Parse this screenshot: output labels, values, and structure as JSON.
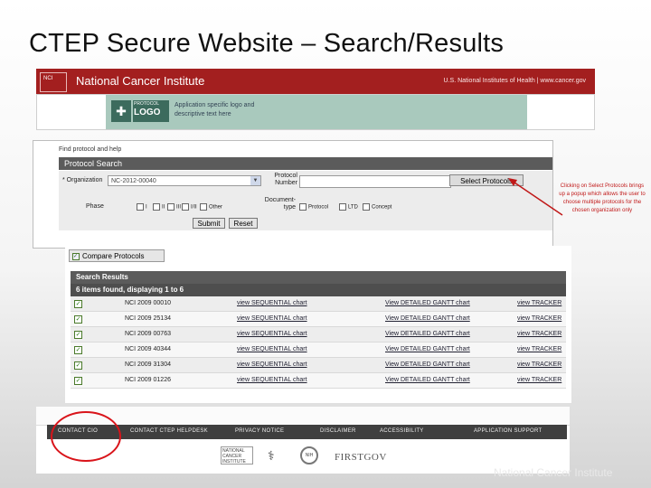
{
  "slide_title": "CTEP Secure Website – Search/Results",
  "banner": {
    "logo_text": "NATIONAL CANCER INSTITUTE",
    "name": "National Cancer Institute",
    "nih_link": "U.S. National Institutes of Health | www.cancer.gov"
  },
  "app_header": {
    "logo_small": "PROTOCOL",
    "logo_big": "LOGO",
    "description": "Application specific logo and descriptive text here"
  },
  "search": {
    "help_link": "Find protocol and help",
    "header": "Protocol Search",
    "organization_label": "* Organization",
    "organization_value": "NC-2012-00040",
    "protocol_number_label": "Protocol Number",
    "select_button": "Select Protocols",
    "phase_label": "Phase",
    "phases": [
      "I",
      "II",
      "III",
      "I/II",
      "Other"
    ],
    "document_type_label": "Document-type",
    "document_types": [
      "Protocol",
      "LTD",
      "Concept"
    ],
    "submit_button": "Submit",
    "reset_button": "Reset"
  },
  "callout": "Clicking on Select Protocols brings up a popup which allows the user to choose multiple protocols for the chosen organization only",
  "compare_button": "Compare Protocols",
  "results": {
    "title": "Search Results",
    "summary": "6 items found, displaying 1 to 6",
    "rows": [
      {
        "id": "NCI 2009 00010",
        "seq": "view SEQUENTIAL chart",
        "gantt": "View DETAILED GANTT chart",
        "tracker": "view TRACKER"
      },
      {
        "id": "NCI 2009 25134",
        "seq": "view SEQUENTIAL chart",
        "gantt": "View DETAILED GANTT chart",
        "tracker": "view TRACKER"
      },
      {
        "id": "NCI 2009 00763",
        "seq": "view SEQUENTIAL chart",
        "gantt": "View DETAILED GANTT chart",
        "tracker": "view TRACKER"
      },
      {
        "id": "NCI 2009 40344",
        "seq": "view SEQUENTIAL chart",
        "gantt": "View DETAILED GANTT chart",
        "tracker": "view TRACKER"
      },
      {
        "id": "NCI 2009 31304",
        "seq": "view SEQUENTIAL chart",
        "gantt": "View DETAILED GANTT chart",
        "tracker": "view TRACKER"
      },
      {
        "id": "NCI 2009 01226",
        "seq": "view SEQUENTIAL chart",
        "gantt": "View DETAILED GANTT chart",
        "tracker": "view TRACKER"
      }
    ]
  },
  "footer": {
    "links": [
      "CONTACT CIO",
      "CONTACT CTEP HELPDESK",
      "PRIVACY NOTICE",
      "DISCLAIMER",
      "ACCESSIBILITY",
      "APPLICATION SUPPORT"
    ],
    "logos": [
      "NATIONAL CANCER INSTITUTE",
      "HHS",
      "NIH",
      "FIRSTGOV"
    ]
  },
  "watermark": "National Cancer Institute",
  "colors": {
    "banner": "#a31f1f",
    "header_gray": "#5b5b5b",
    "highlight": "#d9141a"
  }
}
